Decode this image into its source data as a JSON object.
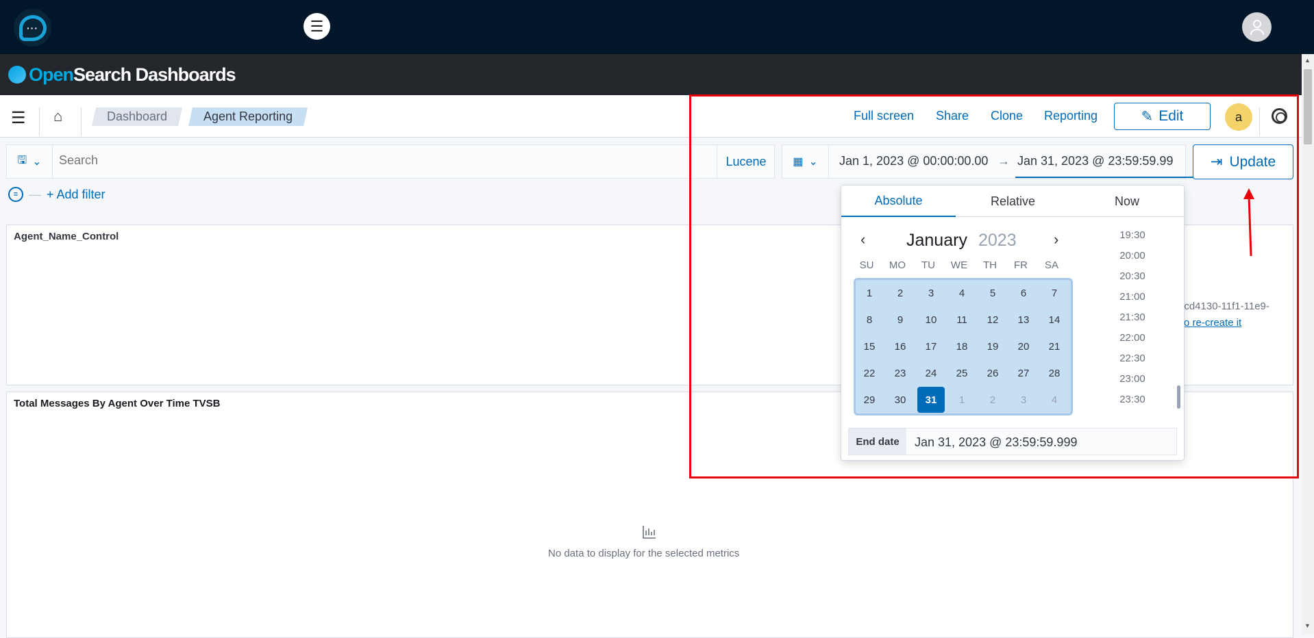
{
  "topbar": {
    "logo_icon": "chat-bubble-logo",
    "menu_icon": "menu-icon",
    "avatar_icon": "user-icon"
  },
  "brand": {
    "part1": "Open",
    "part2": "Search Dashboards"
  },
  "nav": {
    "breadcrumbs": [
      "Dashboard",
      "Agent Reporting"
    ],
    "links": [
      "Full screen",
      "Share",
      "Clone",
      "Reporting"
    ],
    "edit_label": "Edit",
    "avatar_letter": "a"
  },
  "query": {
    "placeholder": "Search",
    "language": "Lucene"
  },
  "time": {
    "start": "Jan 1, 2023 @ 00:00:00.00",
    "end": "Jan 31, 2023 @ 23:59:59.99",
    "update_label": "Update"
  },
  "filter": {
    "add_label": "+ Add filter"
  },
  "panels": [
    {
      "title": "Agent_Name_Control",
      "error_id": "3cd4130-11f1-11e9-",
      "error_link": "o re-create it"
    },
    {
      "title": "Total Messages By Agent Over Time TVSB",
      "empty_text": "No data to display for the selected metrics"
    }
  ],
  "datepicker": {
    "tabs": [
      "Absolute",
      "Relative",
      "Now"
    ],
    "month": "January",
    "year": "2023",
    "weekdays": [
      "SU",
      "MO",
      "TU",
      "WE",
      "TH",
      "FR",
      "SA"
    ],
    "weeks": [
      [
        "1",
        "2",
        "3",
        "4",
        "5",
        "6",
        "7"
      ],
      [
        "8",
        "9",
        "10",
        "11",
        "12",
        "13",
        "14"
      ],
      [
        "15",
        "16",
        "17",
        "18",
        "19",
        "20",
        "21"
      ],
      [
        "22",
        "23",
        "24",
        "25",
        "26",
        "27",
        "28"
      ],
      [
        "29",
        "30",
        "31",
        "1",
        "2",
        "3",
        "4"
      ]
    ],
    "selected_day": "31",
    "times": [
      "19:30",
      "20:00",
      "20:30",
      "21:00",
      "21:30",
      "22:00",
      "22:30",
      "23:00",
      "23:30"
    ],
    "end_label": "End date",
    "end_value": "Jan 31, 2023 @ 23:59:59.999"
  },
  "colors": {
    "accent": "#006bb8",
    "highlight": "#e8000b",
    "topbar": "#011628"
  }
}
